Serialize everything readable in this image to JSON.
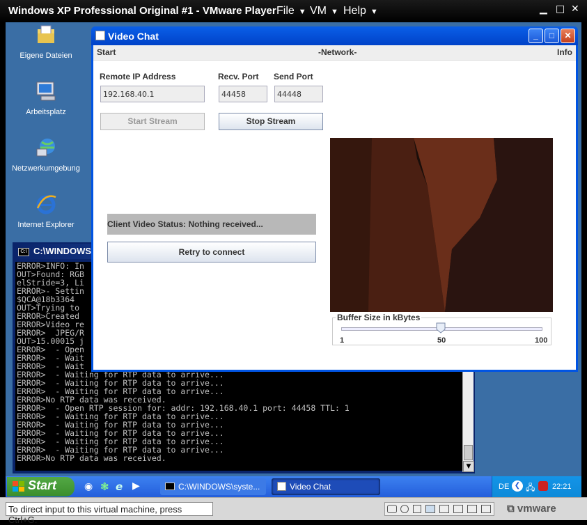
{
  "vmware": {
    "title": "Windows XP Professional Original #1 - VMware Player",
    "menus": [
      "File",
      "VM",
      "Help"
    ],
    "hint": "To direct input to this virtual machine, press Ctrl+G.",
    "logo": "vmware"
  },
  "desktop": {
    "icons": [
      {
        "label": "Eigene Dateien",
        "icon": "folder-documents-icon"
      },
      {
        "label": "Arbeitsplatz",
        "icon": "my-computer-icon"
      },
      {
        "label": "Netzwerkumgebung",
        "icon": "network-icon"
      },
      {
        "label": "Internet Explorer",
        "icon": "internet-explorer-icon"
      }
    ]
  },
  "console": {
    "title": "C:\\WINDOWS\\",
    "lines": [
      "ERROR>INFO: In",
      "OUT>Found: RGB",
      "elStride=3, Li",
      "ERROR>- Settin",
      "$QCA@18b3364",
      "OUT>Trying to",
      "ERROR>Created",
      "ERROR>Video re",
      "ERROR>  JPEG/R",
      "OUT>15.00015 j",
      "ERROR>  - Open",
      "ERROR>  - Wait",
      "ERROR>  - Wait",
      "ERROR>  - Waiting for RTP data to arrive...",
      "ERROR>  - Waiting for RTP data to arrive...",
      "ERROR>  - Waiting for RTP data to arrive...",
      "ERROR>No RTP data was received.",
      "ERROR>  - Open RTP session for: addr: 192.168.40.1 port: 44458 TTL: 1",
      "ERROR>  - Waiting for RTP data to arrive...",
      "ERROR>  - Waiting for RTP data to arrive...",
      "ERROR>  - Waiting for RTP data to arrive...",
      "ERROR>  - Waiting for RTP data to arrive...",
      "ERROR>  - Waiting for RTP data to arrive...",
      "ERROR>No RTP data was received."
    ]
  },
  "videochat": {
    "title": "Video Chat",
    "menu": {
      "start": "Start",
      "network": "-Network-",
      "info": "Info"
    },
    "remote_ip_label": "Remote IP Address",
    "remote_ip": "192.168.40.1",
    "recv_port_label": "Recv. Port",
    "recv_port": "44458",
    "send_port_label": "Send Port",
    "send_port": "44448",
    "start_stream": "Start Stream",
    "stop_stream": "Stop Stream",
    "status": "Client Video Status: Nothing received...",
    "retry": "Retry to connect",
    "buffer_label": "Buffer Size in kBytes",
    "buffer_min": "1",
    "buffer_mid": "50",
    "buffer_max": "100",
    "buffer_value": 50
  },
  "taskbar": {
    "start": "Start",
    "tasks": [
      "C:\\WINDOWS\\syste...",
      "Video Chat"
    ],
    "lang": "DE",
    "clock": "22:21"
  }
}
